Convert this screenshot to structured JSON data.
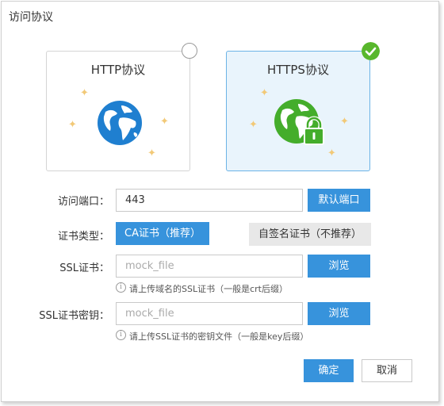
{
  "dialog": {
    "title": "访问协议"
  },
  "protocols": {
    "http": {
      "label": "HTTP协议",
      "selected": false
    },
    "https": {
      "label": "HTTPS协议",
      "selected": true
    }
  },
  "port": {
    "label": "访问端口：",
    "value": "443",
    "default_button": "默认端口"
  },
  "cert_type": {
    "label": "证书类型：",
    "options": [
      "CA证书（推荐）",
      "自签名证书（不推荐）"
    ],
    "selected": "CA证书（推荐）"
  },
  "ssl_cert": {
    "label": "SSL证书：",
    "placeholder": "mock_file",
    "browse": "浏览",
    "hint": "请上传域名的SSL证书（一般是crt后缀）"
  },
  "ssl_key": {
    "label": "SSL证书密钥：",
    "placeholder": "mock_file",
    "browse": "浏览",
    "hint": "请上传SSL证书的密钥文件（一般是key后缀）"
  },
  "footer": {
    "confirm": "确定",
    "cancel": "取消"
  },
  "colors": {
    "accent": "#3793dc",
    "success": "#58b72c",
    "selected_bg": "#e9f4fc"
  }
}
